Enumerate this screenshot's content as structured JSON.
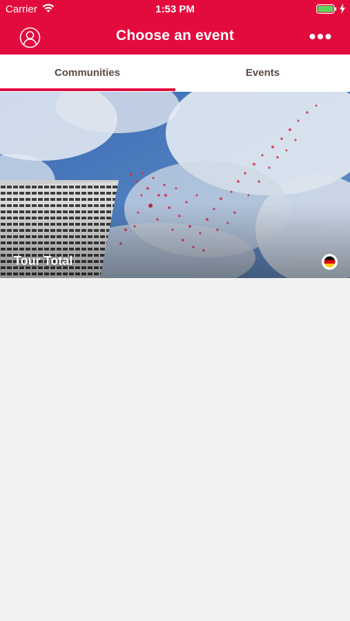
{
  "status_bar": {
    "carrier": "Carrier",
    "time": "1:53 PM",
    "wifi_icon": "wifi-icon",
    "battery_icon": "battery-icon",
    "charging_icon": "bolt-icon"
  },
  "nav": {
    "title": "Choose an event",
    "left_icon": "profile-icon",
    "right_icon": "more-icon"
  },
  "tabs": [
    {
      "label": "Communities",
      "selected": true
    },
    {
      "label": "Events",
      "selected": false
    }
  ],
  "communities": [
    {
      "name": "Tour Total",
      "language_icon": "german-flag-icon"
    }
  ],
  "colors": {
    "brand": "#e30b3e",
    "tab_text": "#5a4a42",
    "background": "#f2f2f2"
  }
}
